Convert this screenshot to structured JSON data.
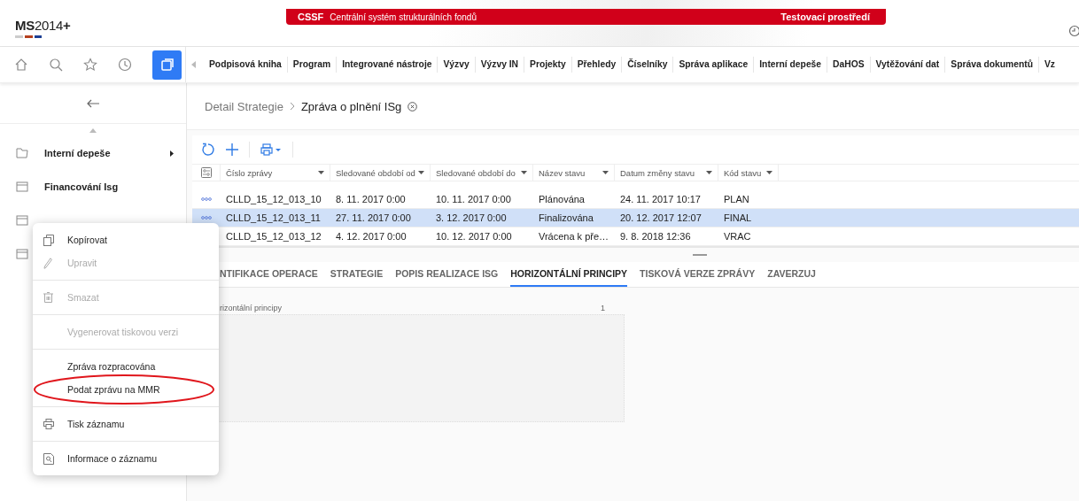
{
  "header": {
    "logo": {
      "bold": "MS",
      "rest": "2014",
      "suffix": "+"
    },
    "banner": {
      "code": "CSSF",
      "name": "Centrální systém strukturálních fondů",
      "environment": "Testovací prostředí"
    }
  },
  "nav_menu": [
    "Podpisová kniha",
    "Program",
    "Integrované nástroje",
    "Výzvy",
    "Výzvy IN",
    "Projekty",
    "Přehledy",
    "Číselníky",
    "Správa aplikace",
    "Interní depeše",
    "DaHOS",
    "Vytěžování dat",
    "Správa dokumentů",
    "Vz"
  ],
  "sidebar": {
    "items": [
      {
        "label": "Interní depeše",
        "kind": "folder",
        "has_submenu": true
      },
      {
        "label": "Financování Isg",
        "kind": "page",
        "has_submenu": false
      },
      {
        "kind": "page"
      },
      {
        "kind": "page"
      }
    ]
  },
  "breadcrumb": {
    "parent": "Detail Strategie",
    "current": "Zpráva o plnění ISg"
  },
  "table": {
    "columns": [
      "Číslo zprávy",
      "Sledované období od",
      "Sledované období do",
      "Název stavu",
      "Datum změny stavu",
      "Kód stavu"
    ],
    "rows": [
      {
        "cells": [
          "CLLD_15_12_013_10",
          "8. 11. 2017 0:00",
          "10. 11. 2017 0:00",
          "Plánována",
          "24. 11. 2017 10:17",
          "PLAN"
        ],
        "selected": false
      },
      {
        "cells": [
          "CLLD_15_12_013_11",
          "27. 11. 2017 0:00",
          "3. 12. 2017 0:00",
          "Finalizována",
          "20. 12. 2017 12:07",
          "FINAL"
        ],
        "selected": true
      },
      {
        "cells": [
          "CLLD_15_12_013_12",
          "4. 12. 2017 0:00",
          "10. 12. 2017 0:00",
          "Vrácena k pře…",
          "9. 8. 2018 12:36",
          "VRAC"
        ],
        "selected": false
      }
    ]
  },
  "tabs": [
    {
      "label": "NTIFIKACE OPERACE",
      "selected": false
    },
    {
      "label": "STRATEGIE",
      "selected": false
    },
    {
      "label": "POPIS REALIZACE ISG",
      "selected": false
    },
    {
      "label": "HORIZONTÁLNÍ PRINCIPY",
      "selected": true
    },
    {
      "label": "TISKOVÁ VERZE ZPRÁVY",
      "selected": false
    },
    {
      "label": "ZAVERZUJ",
      "selected": false
    }
  ],
  "field": {
    "label": "rizontální principy",
    "counter": "1"
  },
  "context_menu": {
    "groups": [
      {
        "items": [
          {
            "label": "Kopírovat",
            "kind": "copy",
            "disabled": false,
            "circled": false
          },
          {
            "label": "Upravit",
            "kind": "edit",
            "disabled": true,
            "circled": false
          }
        ]
      },
      {
        "items": [
          {
            "label": "Smazat",
            "kind": "delete",
            "disabled": true,
            "circled": false
          }
        ]
      },
      {
        "items": [
          {
            "label": "Vygenerovat tiskovou verzi",
            "kind": "text",
            "disabled": true,
            "circled": false
          }
        ]
      },
      {
        "items": [
          {
            "label": "Zpráva rozpracována",
            "kind": "text",
            "disabled": false,
            "circled": false
          },
          {
            "label": "Podat zprávu na MMR",
            "kind": "text",
            "disabled": false,
            "circled": true
          }
        ]
      },
      {
        "items": [
          {
            "label": "Tisk záznamu",
            "kind": "print",
            "disabled": false,
            "circled": false
          }
        ]
      },
      {
        "items": [
          {
            "label": "Informace o záznamu",
            "kind": "info",
            "disabled": false,
            "circled": false
          }
        ]
      }
    ]
  }
}
